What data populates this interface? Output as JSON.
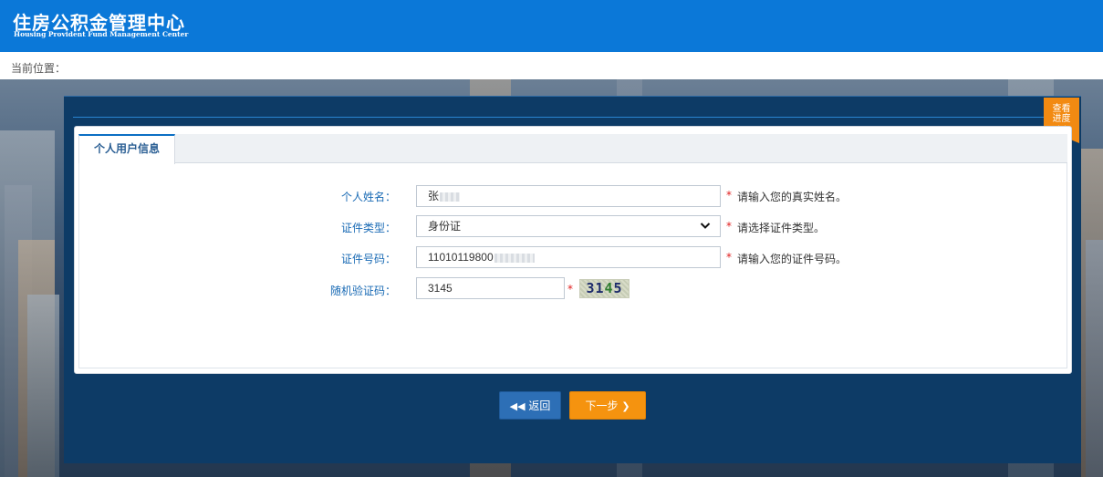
{
  "header": {
    "title_cn": "住房公积金管理中心",
    "title_en": "Housing Provident Fund Management Center",
    "bg_color": "#0b78d8"
  },
  "breadcrumb": {
    "label": "当前位置："
  },
  "progress_tab": {
    "line1": "查看",
    "line2": "进度",
    "icon": "chevron-down-icon"
  },
  "tabs": [
    {
      "label": "个人用户信息",
      "active": true
    }
  ],
  "form": {
    "name": {
      "label": "个人姓名：",
      "value": "张",
      "hint": "请输入您的真实姓名。"
    },
    "id_type": {
      "label": "证件类型：",
      "value": "身份证",
      "hint": "请选择证件类型。"
    },
    "id_number": {
      "label": "证件号码：",
      "value": "11010119800",
      "hint": "请输入您的证件号码。"
    },
    "captcha": {
      "label": "随机验证码：",
      "value": "3145",
      "image_text_a": "31",
      "image_text_b": "4",
      "image_text_c": "5"
    },
    "required_mark": "*"
  },
  "buttons": {
    "back": {
      "label": "返回",
      "icon": "double-chevron-left-icon"
    },
    "next": {
      "label": "下一步",
      "icon": "chevron-right-icon"
    }
  },
  "colors": {
    "accent": "#0b78d8",
    "next_button": "#f5930f",
    "back_button": "#2d6fb6",
    "progress_tab": "#f28a12"
  }
}
